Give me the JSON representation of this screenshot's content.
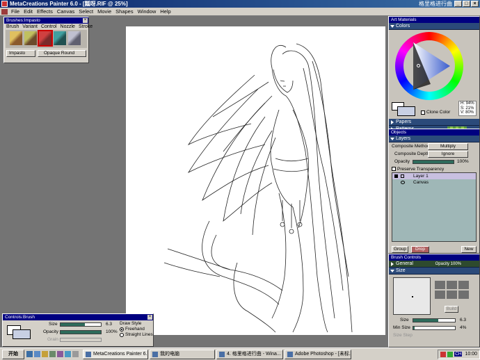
{
  "app": {
    "title": "MetaCreations Painter 6.0 - [瓢呀.RIF @ 25%]",
    "right_title": "格里格进行曲"
  },
  "menu": [
    "File",
    "Edit",
    "Effects",
    "Canvas",
    "Select",
    "Movie",
    "Shapes",
    "Window",
    "Help"
  ],
  "brushes_panel": {
    "title": "Brushes:Impasto",
    "tabs": [
      "Brush",
      "Variant",
      "Control",
      "Nozzle",
      "Stroke"
    ],
    "category": "Impasto",
    "variant": "Opaque Round"
  },
  "art_materials": {
    "title": "Art Materials",
    "colors_label": "Colors",
    "hsv": [
      "H: 94%",
      "S: 21%",
      "V: 80%"
    ],
    "clone_color": "Clone Color",
    "papers_label": "Papers",
    "patterns_label": "Patterns"
  },
  "objects": {
    "title": "Objects",
    "layers_label": "Layers",
    "composite_method_label": "Composite Method",
    "composite_method_value": "Multiply",
    "composite_depth_label": "Composite Depth",
    "composite_depth_value": "Ignore",
    "opacity_label": "Opacity",
    "opacity_value": "100%",
    "opacity_fraction": 1.0,
    "preserve_label": "Preserve Transparency",
    "layers": [
      "Layer 1",
      "Canvas"
    ],
    "buttons": [
      "Group",
      "Drop",
      "New"
    ]
  },
  "brush_controls": {
    "title": "Brush Controls",
    "general_label": "General",
    "general_opacity": "Opacity 100%",
    "size_label": "Size",
    "build_label": "Build",
    "size_text": "Size",
    "size_value": "6.3",
    "size_fraction": 0.6,
    "min_size_text": "Min Size",
    "min_size_value": "4%",
    "min_size_fraction": 0.04,
    "size_step_text": "Size Step"
  },
  "controls_panel": {
    "title": "Controls:Brush",
    "size_label": "Size",
    "size_value": "6.3",
    "size_fraction": 0.6,
    "opacity_label": "Opacity",
    "opacity_value": "100%",
    "opacity_fraction": 1.0,
    "grain_label": "Grain",
    "draw_style_label": "Draw Style",
    "freehand_label": "Freehand",
    "straight_label": "Straight Lines"
  },
  "taskbar": {
    "start": "开始",
    "tasks": [
      "MetaCreations Painter 6....",
      "我的电脑",
      "4. 格里格进行曲 - Wina...",
      "Adobe Photoshop - [未标..."
    ],
    "ime": "CH",
    "clock": "10:00"
  },
  "colors": {
    "title_blue": "#0a246a",
    "panel_gray": "#d4d0c8",
    "section_blue": "#2b4a7a",
    "slider_green": "#2e6b5b",
    "layer_select": "#c8c0e0",
    "layer_list_bg": "#9fb7b7"
  }
}
